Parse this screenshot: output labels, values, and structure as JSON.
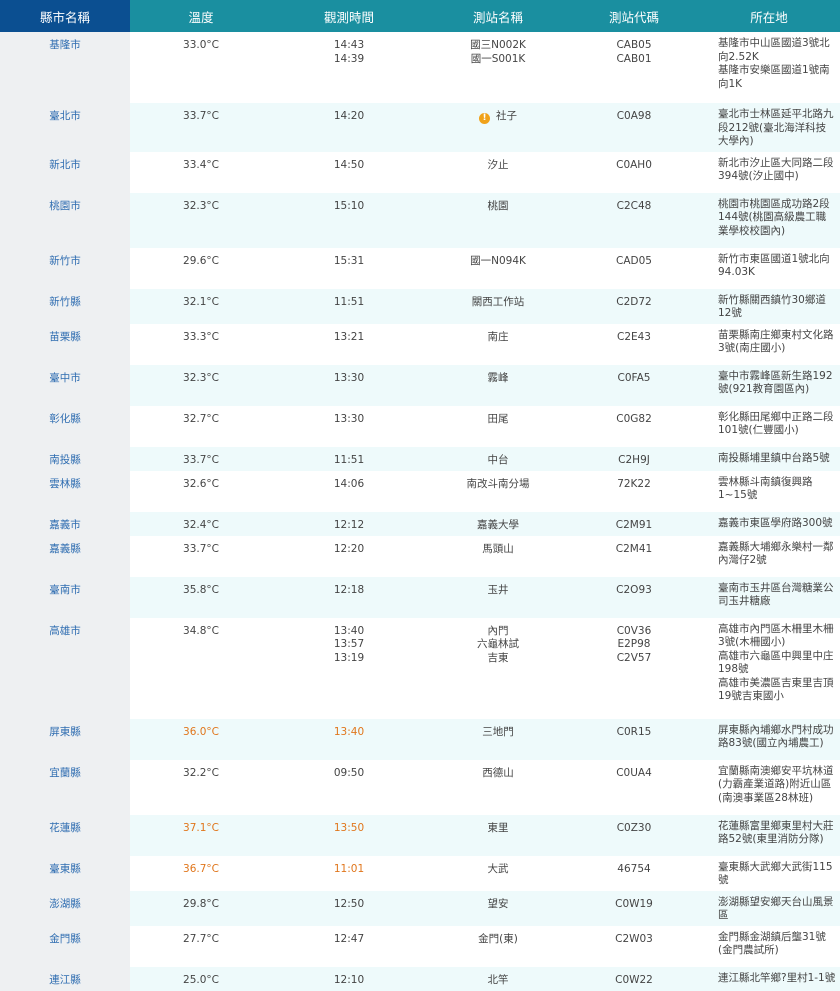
{
  "headers": [
    "縣市名稱",
    "溫度",
    "觀測時間",
    "測站名稱",
    "測站代碼",
    "所在地"
  ],
  "rows": [
    {
      "city": "基隆市",
      "temp": "33.0°C",
      "times": [
        "14:43",
        "14:39"
      ],
      "names": [
        "國三N002K",
        "國一S001K"
      ],
      "codes": [
        "CAB05",
        "CAB01"
      ],
      "addrs": [
        "基隆市中山區國道3號北向2.52K",
        "基隆市安樂區國道1號南向1K"
      ],
      "hot": false,
      "warn": false
    },
    {
      "city": "臺北市",
      "temp": "33.7°C",
      "times": [
        "14:20"
      ],
      "names": [
        "社子"
      ],
      "codes": [
        "C0A98"
      ],
      "addrs": [
        "臺北市士林區延平北路九段212號(臺北海洋科技大學內)"
      ],
      "hot": false,
      "warn": true
    },
    {
      "city": "新北市",
      "temp": "33.4°C",
      "times": [
        "14:50"
      ],
      "names": [
        "汐止"
      ],
      "codes": [
        "C0AH0"
      ],
      "addrs": [
        "新北市汐止區大同路二段394號(汐止國中)"
      ],
      "hot": false,
      "warn": false
    },
    {
      "city": "桃園市",
      "temp": "32.3°C",
      "times": [
        "15:10"
      ],
      "names": [
        "桃園"
      ],
      "codes": [
        "C2C48"
      ],
      "addrs": [
        "桃園市桃園區成功路2段144號(桃園高級農工職業學校校園內)"
      ],
      "hot": false,
      "warn": false
    },
    {
      "city": "新竹市",
      "temp": "29.6°C",
      "times": [
        "15:31"
      ],
      "names": [
        "國一N094K"
      ],
      "codes": [
        "CAD05"
      ],
      "addrs": [
        "新竹市東區國道1號北向94.03K"
      ],
      "hot": false,
      "warn": false
    },
    {
      "city": "新竹縣",
      "temp": "32.1°C",
      "times": [
        "11:51"
      ],
      "names": [
        "關西工作站"
      ],
      "codes": [
        "C2D72"
      ],
      "addrs": [
        "新竹縣關西鎮竹30鄉道12號"
      ],
      "hot": false,
      "warn": false
    },
    {
      "city": "苗栗縣",
      "temp": "33.3°C",
      "times": [
        "13:21"
      ],
      "names": [
        "南庄"
      ],
      "codes": [
        "C2E43"
      ],
      "addrs": [
        "苗栗縣南庄鄉東村文化路3號(南庄國小)"
      ],
      "hot": false,
      "warn": false
    },
    {
      "city": "臺中市",
      "temp": "32.3°C",
      "times": [
        "13:30"
      ],
      "names": [
        "霧峰"
      ],
      "codes": [
        "C0FA5"
      ],
      "addrs": [
        "臺中市霧峰區新生路192號(921教育園區內)"
      ],
      "hot": false,
      "warn": false
    },
    {
      "city": "彰化縣",
      "temp": "32.7°C",
      "times": [
        "13:30"
      ],
      "names": [
        "田尾"
      ],
      "codes": [
        "C0G82"
      ],
      "addrs": [
        "彰化縣田尾鄉中正路二段101號(仁豐國小)"
      ],
      "hot": false,
      "warn": false
    },
    {
      "city": "南投縣",
      "temp": "33.7°C",
      "times": [
        "11:51"
      ],
      "names": [
        "中台"
      ],
      "codes": [
        "C2H9J"
      ],
      "addrs": [
        "南投縣埔里鎮中台路5號"
      ],
      "hot": false,
      "warn": false
    },
    {
      "city": "雲林縣",
      "temp": "32.6°C",
      "times": [
        "14:06"
      ],
      "names": [
        "南改斗南分場"
      ],
      "codes": [
        "72K22"
      ],
      "addrs": [
        "雲林縣斗南鎮復興路1~15號"
      ],
      "hot": false,
      "warn": false
    },
    {
      "city": "嘉義市",
      "temp": "32.4°C",
      "times": [
        "12:12"
      ],
      "names": [
        "嘉義大學"
      ],
      "codes": [
        "C2M91"
      ],
      "addrs": [
        "嘉義市東區學府路300號"
      ],
      "hot": false,
      "warn": false
    },
    {
      "city": "嘉義縣",
      "temp": "33.7°C",
      "times": [
        "12:20"
      ],
      "names": [
        "馬頭山"
      ],
      "codes": [
        "C2M41"
      ],
      "addrs": [
        "嘉義縣大埔鄉永樂村一鄰內灣仔2號"
      ],
      "hot": false,
      "warn": false
    },
    {
      "city": "臺南市",
      "temp": "35.8°C",
      "times": [
        "12:18"
      ],
      "names": [
        "玉井"
      ],
      "codes": [
        "C2O93"
      ],
      "addrs": [
        "臺南市玉井區台灣糖業公司玉井糖廠"
      ],
      "hot": false,
      "warn": false
    },
    {
      "city": "高雄市",
      "temp": "34.8°C",
      "times": [
        "13:40",
        "13:57",
        "13:19"
      ],
      "names": [
        "內門",
        "六龜林試",
        "吉東"
      ],
      "codes": [
        "C0V36",
        "E2P98",
        "C2V57"
      ],
      "addrs": [
        "高雄市內門區木柵里木柵3號(木柵國小)",
        "高雄市六龜區中興里中庄198號",
        "高雄市美濃區吉東里吉頂19號吉東國小"
      ],
      "hot": false,
      "warn": false
    },
    {
      "city": "屏東縣",
      "temp": "36.0°C",
      "times": [
        "13:40"
      ],
      "names": [
        "三地門"
      ],
      "codes": [
        "C0R15"
      ],
      "addrs": [
        "屏東縣內埔鄉水門村成功路83號(國立內埔農工)"
      ],
      "hot": true,
      "warn": false
    },
    {
      "city": "宜蘭縣",
      "temp": "32.2°C",
      "times": [
        "09:50"
      ],
      "names": [
        "西德山"
      ],
      "codes": [
        "C0UA4"
      ],
      "addrs": [
        "宜蘭縣南澳鄉安平坑林道(力霸產業道路)附近山區(南澳事業區28林班)"
      ],
      "hot": false,
      "warn": false
    },
    {
      "city": "花蓮縣",
      "temp": "37.1°C",
      "times": [
        "13:50"
      ],
      "names": [
        "東里"
      ],
      "codes": [
        "C0Z30"
      ],
      "addrs": [
        "花蓮縣富里鄉東里村大莊路52號(東里消防分隊)"
      ],
      "hot": true,
      "warn": false
    },
    {
      "city": "臺東縣",
      "temp": "36.7°C",
      "times": [
        "11:01"
      ],
      "names": [
        "大武"
      ],
      "codes": [
        "46754"
      ],
      "addrs": [
        "臺東縣大武鄉大武街115號"
      ],
      "hot": true,
      "warn": false
    },
    {
      "city": "澎湖縣",
      "temp": "29.8°C",
      "times": [
        "12:50"
      ],
      "names": [
        "望安"
      ],
      "codes": [
        "C0W19"
      ],
      "addrs": [
        "澎湖縣望安鄉天台山風景區"
      ],
      "hot": false,
      "warn": false
    },
    {
      "city": "金門縣",
      "temp": "27.7°C",
      "times": [
        "12:47"
      ],
      "names": [
        "金門(東)"
      ],
      "codes": [
        "C2W03"
      ],
      "addrs": [
        "金門縣金湖鎮后壟31號(金門農試所)"
      ],
      "hot": false,
      "warn": false
    },
    {
      "city": "連江縣",
      "temp": "25.0°C",
      "times": [
        "12:10"
      ],
      "names": [
        "北竿"
      ],
      "codes": [
        "C0W22"
      ],
      "addrs": [
        "連江縣北竿鄉?里村1-1號"
      ],
      "hot": false,
      "warn": false
    }
  ],
  "colors": {
    "header_city": "#0b4f91",
    "header": "#1a8fa0",
    "hot": "#e0761c",
    "link": "#2f6db1",
    "alt_row": "#eefafb"
  }
}
